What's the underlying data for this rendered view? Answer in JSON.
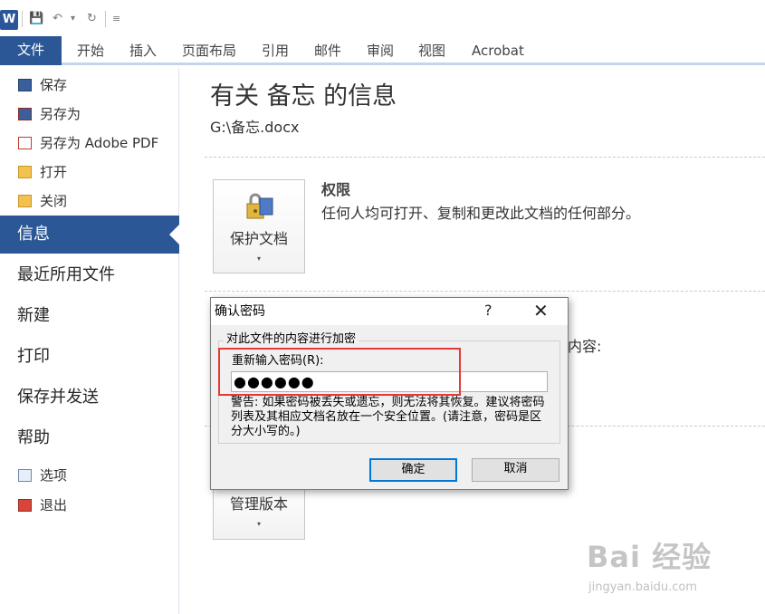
{
  "qat": {
    "app_icon": "W",
    "save_glyph": "💾",
    "undo_glyph": "↶",
    "dropdown_glyph": "▾",
    "redo_glyph": "↻",
    "customize_glyph": "≡"
  },
  "ribbon": {
    "file_tab": "文件",
    "tabs": [
      "开始",
      "插入",
      "页面布局",
      "引用",
      "邮件",
      "审阅",
      "视图",
      "Acrobat"
    ]
  },
  "nav": {
    "small_items": [
      "保存",
      "另存为",
      "另存为 Adobe PDF",
      "打开",
      "关闭"
    ],
    "selected": "信息",
    "big_items": [
      "最近所用文件",
      "新建",
      "打印",
      "保存并发送",
      "帮助"
    ],
    "bottom_items": [
      "选项",
      "退出"
    ]
  },
  "main": {
    "title": "有关 备忘 的信息",
    "path": "G:\\备忘.docx",
    "protect_button": "保护文档",
    "permission_title": "权限",
    "permission_desc": "任何人均可打开、复制和更改此文档的任何部分。",
    "partial_text": "内容:",
    "manage_button": "管理版本",
    "dropdown_glyph": "▾"
  },
  "dialog": {
    "title": "确认密码",
    "help": "?",
    "close": "✕",
    "group_label": "对此文件的内容进行加密",
    "password_label": "重新输入密码(R):",
    "password_value": "●●●●●●",
    "warning": "警告: 如果密码被丢失或遗忘，则无法将其恢复。建议将密码列表及其相应文档名放在一个安全位置。(请注意，密码是区分大小写的。)",
    "ok": "确定",
    "cancel": "取消"
  },
  "watermark": {
    "brand": "Bai 经验",
    "url": "jingyan.baidu.com"
  },
  "colors": {
    "accent_blue": "#2b5797",
    "highlight_red": "#e53935"
  }
}
